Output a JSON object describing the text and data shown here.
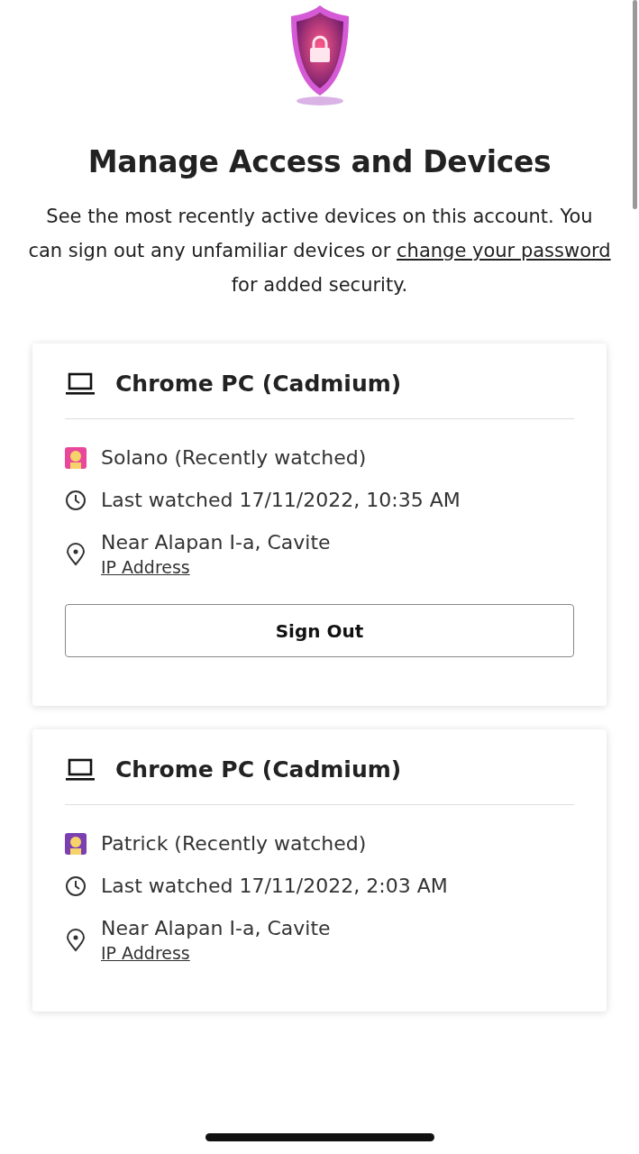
{
  "title": "Manage Access and Devices",
  "description": {
    "before": "See the most recently active devices on this account. You can sign out any unfamiliar devices or",
    "link": "change your password",
    "after": "for added security."
  },
  "devices": [
    {
      "name": "Chrome PC (Cadmium)",
      "profile": "Solano (Recently watched)",
      "color": "#e8479a",
      "last_watched": "Last watched 17/11/2022, 10:35 AM",
      "location": "Near Alapan I-a, Cavite",
      "ip_link": "IP Address",
      "button": "Sign Out"
    },
    {
      "name": "Chrome PC (Cadmium)",
      "profile": "Patrick (Recently watched)",
      "color": "#7b3fb0",
      "last_watched": "Last watched 17/11/2022, 2:03 AM",
      "location": "Near Alapan I-a, Cavite",
      "ip_link": "IP Address"
    }
  ]
}
